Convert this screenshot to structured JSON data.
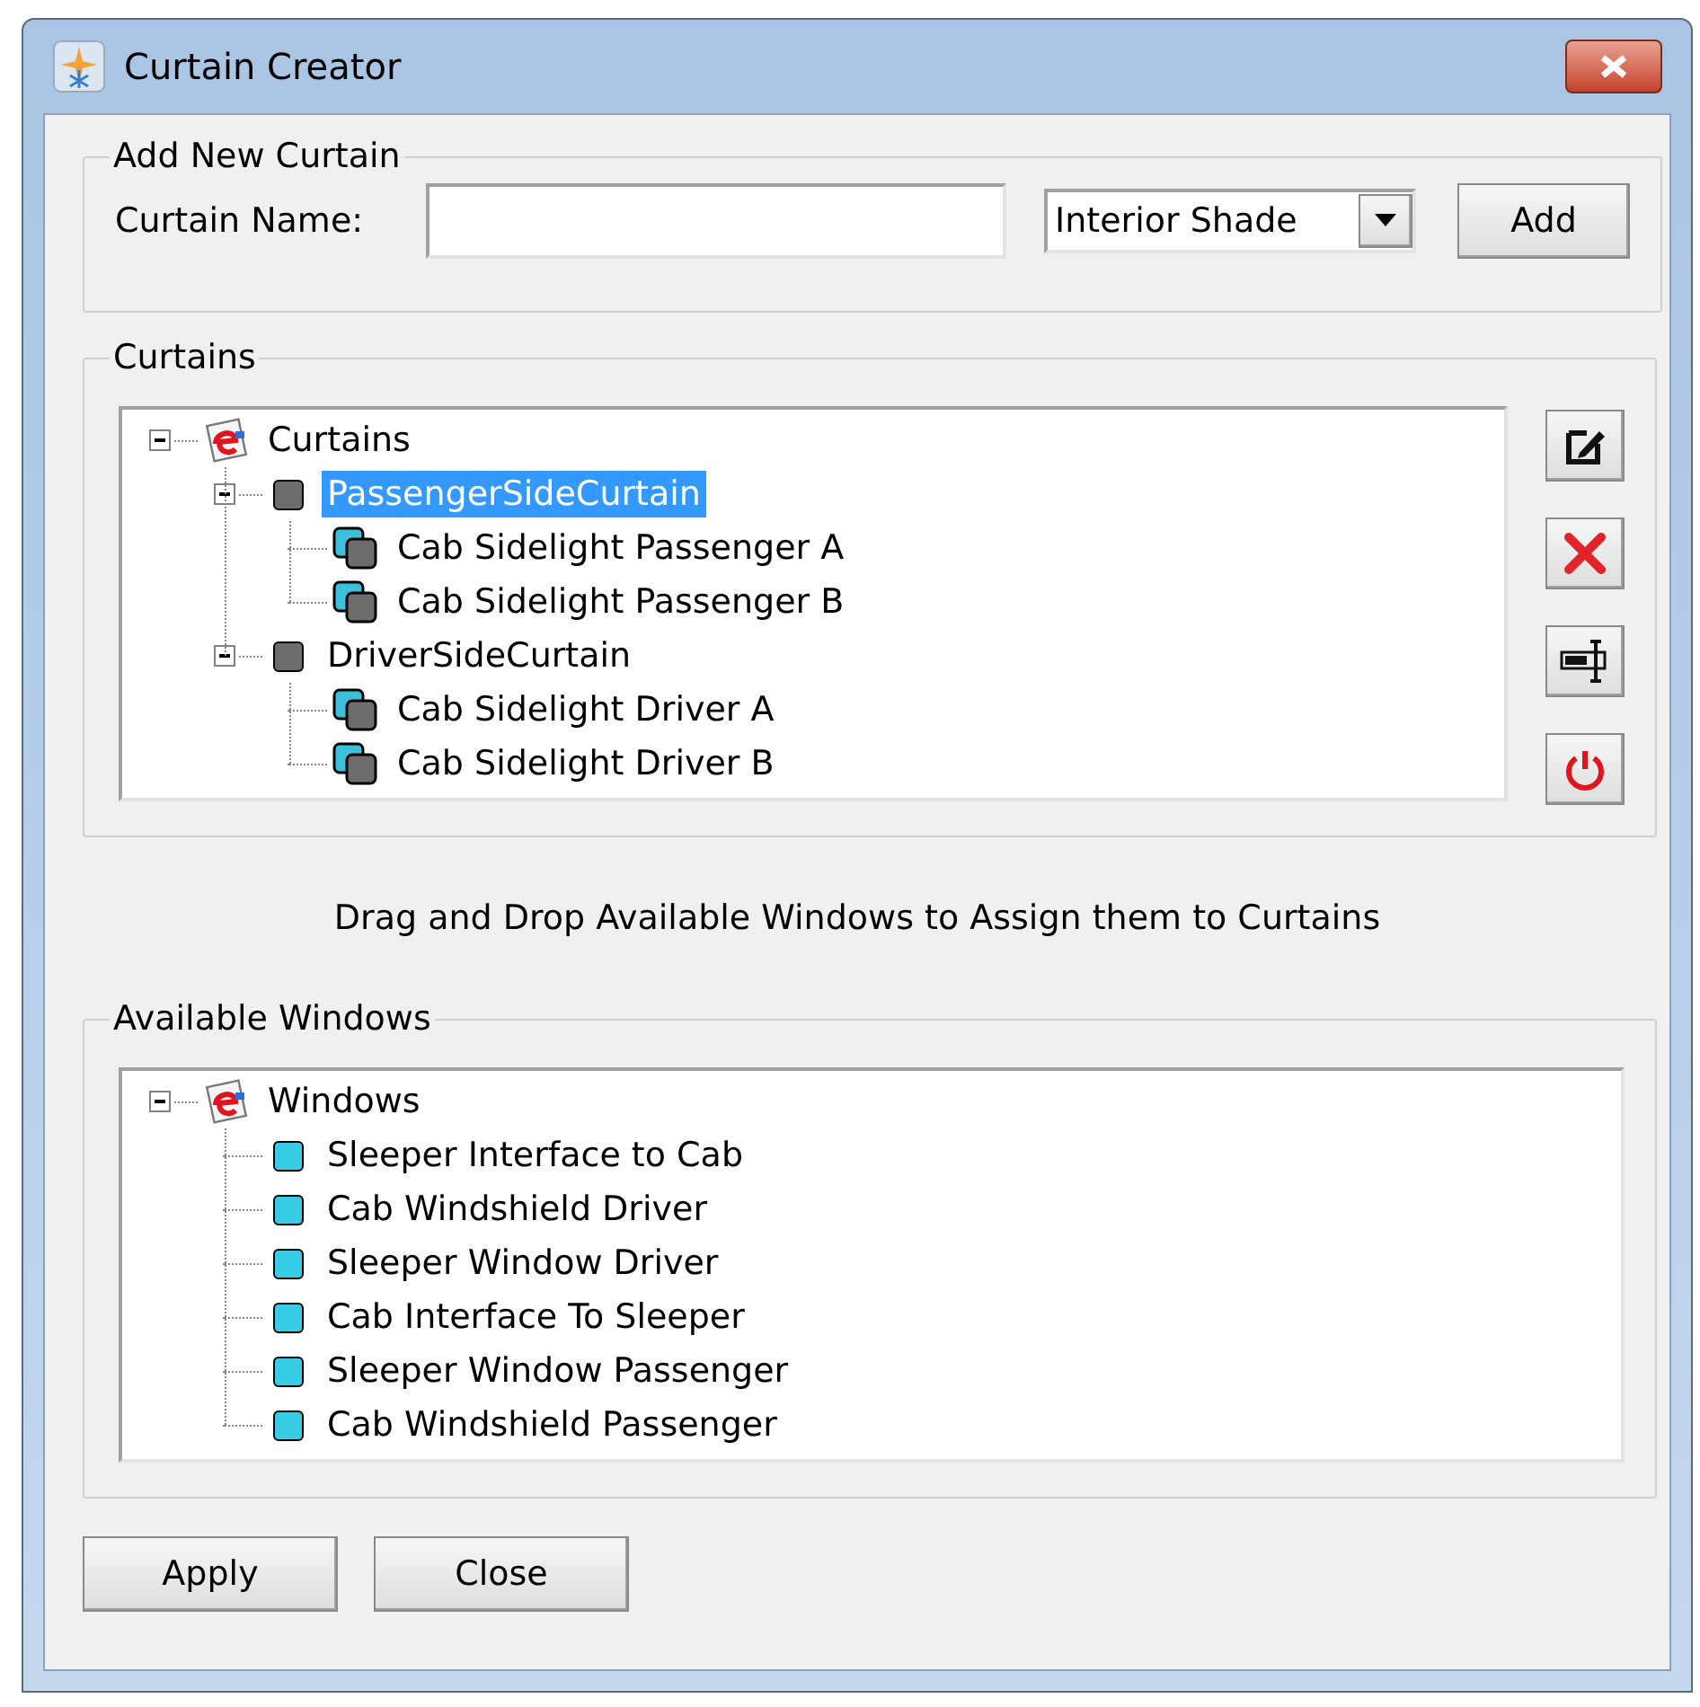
{
  "window": {
    "title": "Curtain Creator"
  },
  "add_group": {
    "title": "Add New Curtain",
    "name_label": "Curtain Name:",
    "type_select": {
      "value": "Interior Shade"
    },
    "add_button": "Add"
  },
  "curtains_group": {
    "title": "Curtains",
    "tree": [
      {
        "label": "Curtains",
        "kind": "root",
        "selected": false,
        "expanded": true,
        "children": [
          {
            "label": "PassengerSideCurtain",
            "kind": "curtain",
            "selected": true,
            "expanded": true,
            "children": [
              {
                "label": "Cab Sidelight Passenger A",
                "kind": "assigned",
                "selected": false
              },
              {
                "label": "Cab Sidelight Passenger B",
                "kind": "assigned",
                "selected": false
              }
            ]
          },
          {
            "label": "DriverSideCurtain",
            "kind": "curtain",
            "selected": false,
            "expanded": true,
            "children": [
              {
                "label": "Cab Sidelight Driver A",
                "kind": "assigned",
                "selected": false
              },
              {
                "label": "Cab Sidelight Driver B",
                "kind": "assigned",
                "selected": false
              }
            ]
          }
        ]
      }
    ],
    "tool_buttons": [
      {
        "kind": "edit"
      },
      {
        "kind": "delete"
      },
      {
        "kind": "rename"
      },
      {
        "kind": "power"
      }
    ]
  },
  "hint": "Drag and Drop Available Windows to Assign them to Curtains",
  "windows_group": {
    "title": "Available Windows",
    "tree": [
      {
        "label": "Windows",
        "kind": "root",
        "selected": false,
        "expanded": true,
        "children": [
          {
            "label": "Sleeper Interface to Cab",
            "kind": "window",
            "selected": false
          },
          {
            "label": "Cab Windshield Driver",
            "kind": "window",
            "selected": false
          },
          {
            "label": "Sleeper Window Driver",
            "kind": "window",
            "selected": false
          },
          {
            "label": "Cab Interface To Sleeper",
            "kind": "window",
            "selected": false
          },
          {
            "label": "Sleeper Window Passenger",
            "kind": "window",
            "selected": false
          },
          {
            "label": "Cab Windshield Passenger",
            "kind": "window",
            "selected": false
          }
        ]
      }
    ]
  },
  "buttons": [
    "Apply",
    "Close"
  ]
}
